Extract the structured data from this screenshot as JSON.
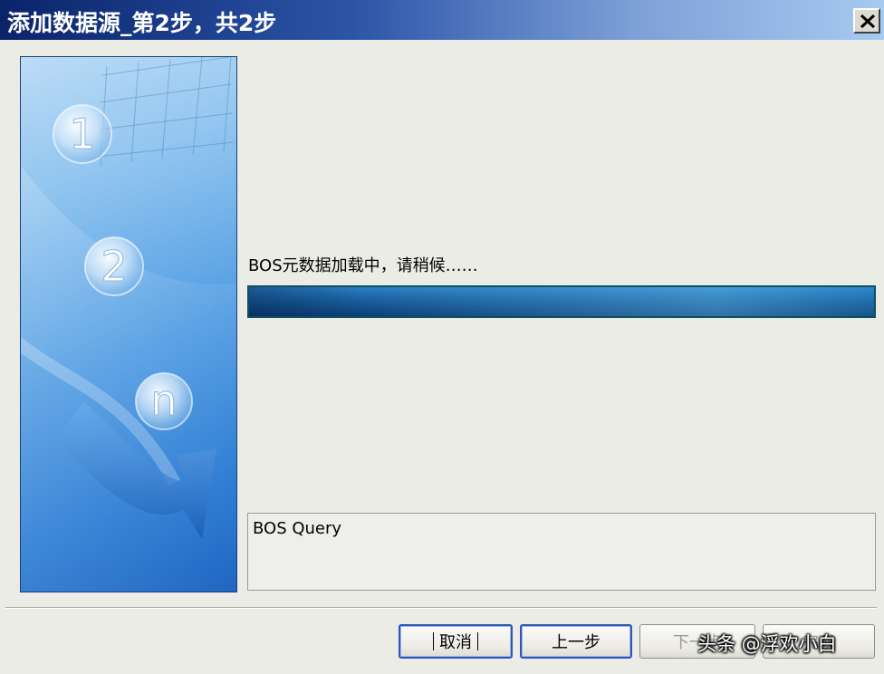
{
  "window": {
    "title": "添加数据源_第2步，共2步",
    "close_label": "X"
  },
  "banner": {
    "steps": [
      "1",
      "2",
      "n"
    ]
  },
  "main": {
    "status_text": "BOS元数据加载中，请稍候……",
    "progress_fraction": 1.0,
    "info_text": "BOS Query"
  },
  "buttons": {
    "cancel": "取消",
    "prev": "上一步",
    "next": "下一步",
    "finish": "完成"
  },
  "watermark": "头条 @浮欢小白",
  "colors": {
    "title_bar_start": "#0a246a",
    "title_bar_end": "#a6caf0",
    "progress": "#1a5f9e",
    "button_focus": "#2f56b5"
  }
}
